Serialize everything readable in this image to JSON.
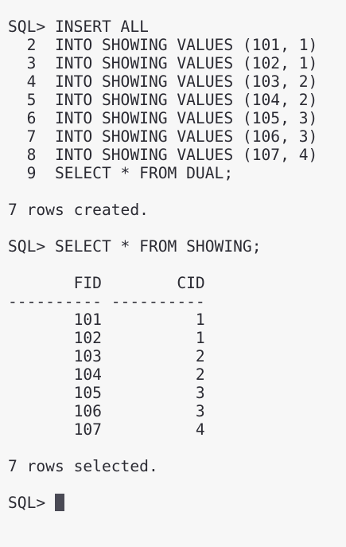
{
  "terminal": {
    "lines": [
      "SQL> INSERT ALL",
      "  2  INTO SHOWING VALUES (101, 1)",
      "  3  INTO SHOWING VALUES (102, 1)",
      "  4  INTO SHOWING VALUES (103, 2)",
      "  5  INTO SHOWING VALUES (104, 2)",
      "  6  INTO SHOWING VALUES (105, 3)",
      "  7  INTO SHOWING VALUES (106, 3)",
      "  8  INTO SHOWING VALUES (107, 4)",
      "  9  SELECT * FROM DUAL;",
      "",
      "7 rows created.",
      "",
      "SQL> SELECT * FROM SHOWING;",
      "",
      "       FID        CID",
      "---------- ----------",
      "       101          1",
      "       102          1",
      "       103          2",
      "       104          2",
      "       105          3",
      "       106          3",
      "       107          4",
      "",
      "7 rows selected.",
      "",
      "SQL> "
    ]
  }
}
